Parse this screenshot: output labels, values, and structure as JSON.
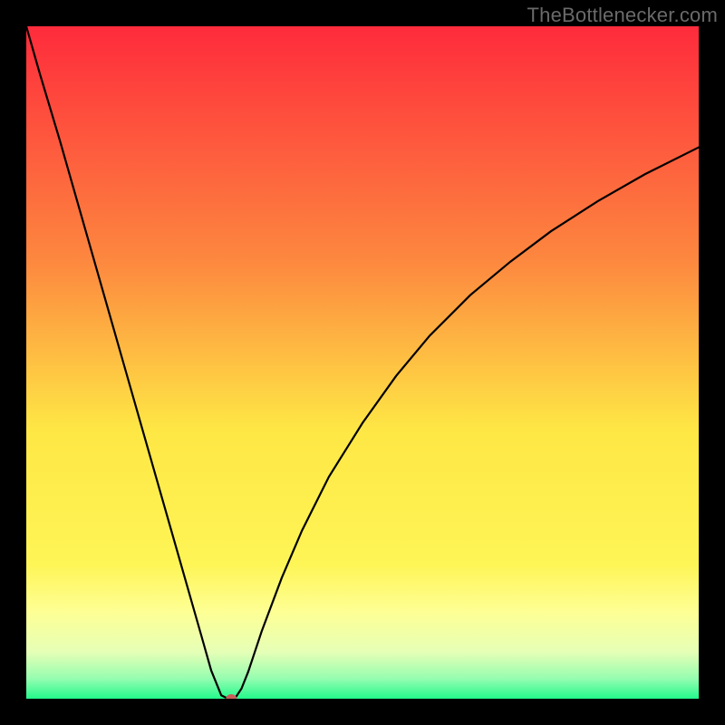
{
  "watermark": "TheBottlenecker.com",
  "colors": {
    "gradient_top": "#fe2b3c",
    "gradient_mid_upper": "#fd883f",
    "gradient_mid": "#fee745",
    "gradient_mid_lower": "#feff94",
    "gradient_lower": "#e6ffb6",
    "gradient_bottom": "#23f98c",
    "curve": "#000000",
    "marker": "#c95f5a",
    "frame": "#000000"
  },
  "chart_data": {
    "type": "line",
    "title": "",
    "xlabel": "",
    "ylabel": "",
    "xlim": [
      0,
      100
    ],
    "ylim": [
      0,
      100
    ],
    "grid": false,
    "legend": false,
    "series": [
      {
        "name": "bottleneck-curve",
        "x": [
          0,
          2,
          5,
          8,
          11,
          14,
          17,
          20,
          23,
          26,
          27.5,
          29,
          30,
          31,
          32,
          33,
          34,
          35,
          38,
          41,
          45,
          50,
          55,
          60,
          66,
          72,
          78,
          85,
          92,
          100
        ],
        "y": [
          100,
          93,
          83,
          72.5,
          62,
          51.5,
          41,
          30.5,
          20,
          9.5,
          4.2,
          0.5,
          0,
          0,
          1.5,
          4,
          7,
          10,
          18,
          25,
          33,
          41,
          48,
          54,
          60,
          65,
          69.5,
          74,
          78,
          82
        ]
      }
    ],
    "marker": {
      "x": 30.5,
      "y": 0
    },
    "gradient_stops": [
      {
        "pct": 0,
        "color": "#fe2b3c"
      },
      {
        "pct": 35,
        "color": "#fd883f"
      },
      {
        "pct": 60,
        "color": "#fee745"
      },
      {
        "pct": 80,
        "color": "#fef556"
      },
      {
        "pct": 87,
        "color": "#feff94"
      },
      {
        "pct": 93,
        "color": "#e6ffb6"
      },
      {
        "pct": 97,
        "color": "#96fdb0"
      },
      {
        "pct": 100,
        "color": "#23f98c"
      }
    ]
  }
}
